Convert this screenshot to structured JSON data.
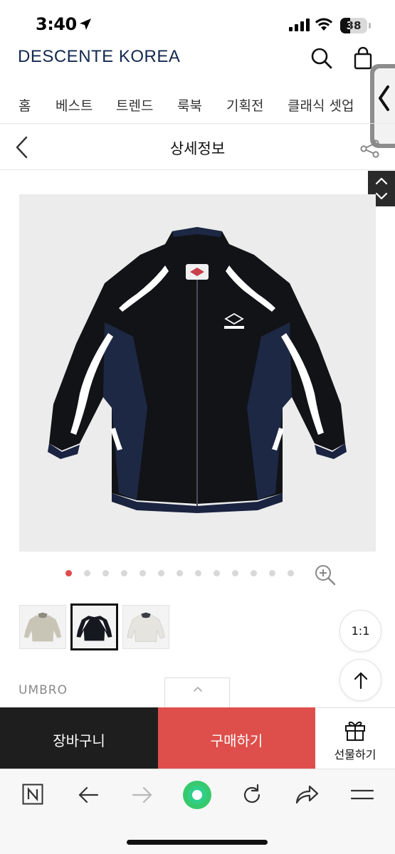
{
  "status_bar": {
    "time": "3:40",
    "battery_level": "38",
    "battery_fraction": 0.38
  },
  "header": {
    "brand_logo": "DESCENTE KOREA",
    "icons": [
      "search-icon",
      "cart-icon"
    ]
  },
  "categories": [
    "홈",
    "베스트",
    "트렌드",
    "룩북",
    "기획전",
    "클래식 셋업"
  ],
  "page": {
    "title": "상세정보"
  },
  "gallery": {
    "image_count": 13,
    "active_index": 0,
    "thumbnail_colors": [
      "#c9c5b6",
      "#15181f",
      "#e6e4df"
    ],
    "selected_thumbnail": 1,
    "product_colors": {
      "body": "#111317",
      "panel": "#1d2844",
      "stripe": "#ffffff"
    }
  },
  "controls": {
    "ratio_label": "1:1"
  },
  "product": {
    "brand": "UMBRO"
  },
  "action_bar": {
    "cart_label": "장바구니",
    "buy_label": "구매하기",
    "gift_label": "선물하기",
    "buy_color": "#de4f4b",
    "cart_color": "#1e1e1e"
  },
  "browser_toolbar": {
    "items": [
      "n-icon",
      "back-arrow-icon",
      "forward-arrow-icon",
      "green-dot-icon",
      "reload-icon",
      "share-icon",
      "menu-icon"
    ]
  }
}
